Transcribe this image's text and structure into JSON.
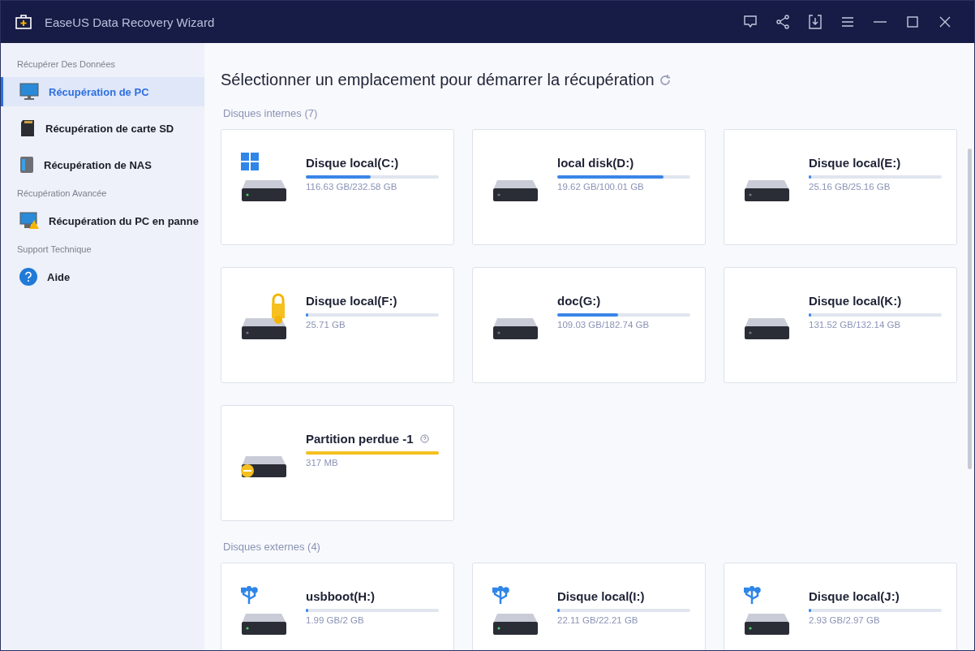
{
  "window": {
    "title": "EaseUS Data Recovery Wizard"
  },
  "sidebar": {
    "sections": [
      {
        "label": "Récupérer Des Données",
        "items": [
          {
            "label": "Récupération de PC",
            "kind": "monitor",
            "selected": true
          },
          {
            "label": "Récupération de carte SD",
            "kind": "sd",
            "selected": false
          },
          {
            "label": "Récupération de NAS",
            "kind": "nas",
            "selected": false
          }
        ]
      },
      {
        "label": "Récupération Avancée",
        "items": [
          {
            "label": "Récupération du PC en panne",
            "kind": "crash",
            "selected": false
          }
        ]
      },
      {
        "label": "Support Technique",
        "items": [
          {
            "label": "Aide",
            "kind": "help",
            "selected": false
          }
        ]
      }
    ]
  },
  "main": {
    "title": "Sélectionner un emplacement pour démarrer la récupération",
    "groups": [
      {
        "label": "Disques internes (7)",
        "drives": [
          {
            "name": "Disque local(C:)",
            "size": "116.63 GB/232.58 GB",
            "level": 0.49,
            "kind": "windows"
          },
          {
            "name": "local disk(D:)",
            "size": "19.62 GB/100.01 GB",
            "level": 0.8,
            "kind": "plain"
          },
          {
            "name": "Disque local(E:)",
            "size": "25.16 GB/25.16 GB",
            "level": 0.02,
            "kind": "plain"
          },
          {
            "name": "Disque local(F:)",
            "size": "25.71 GB",
            "level": 0.02,
            "kind": "locked"
          },
          {
            "name": "doc(G:)",
            "size": "109.03 GB/182.74 GB",
            "level": 0.46,
            "kind": "plain"
          },
          {
            "name": "Disque local(K:)",
            "size": "131.52 GB/132.14 GB",
            "level": 0.02,
            "kind": "plain"
          },
          {
            "name": "Partition perdue -1",
            "size": "317 MB",
            "level": 1,
            "kind": "lost"
          }
        ]
      },
      {
        "label": "Disques externes (4)",
        "drives": [
          {
            "name": "usbboot(H:)",
            "size": "1.99 GB/2 GB",
            "level": 0.02,
            "kind": "usb"
          },
          {
            "name": "Disque local(I:)",
            "size": "22.11 GB/22.21 GB",
            "level": 0.02,
            "kind": "usb"
          },
          {
            "name": "Disque local(J:)",
            "size": "2.93 GB/2.97 GB",
            "level": 0.02,
            "kind": "usb"
          }
        ]
      }
    ]
  }
}
